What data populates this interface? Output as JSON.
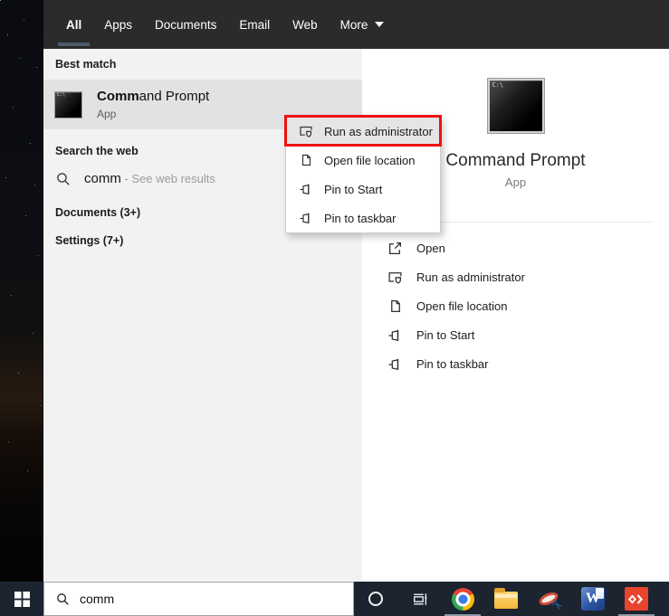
{
  "header": {
    "tabs": [
      {
        "label": "All",
        "selected": true
      },
      {
        "label": "Apps",
        "selected": false
      },
      {
        "label": "Documents",
        "selected": false
      },
      {
        "label": "Email",
        "selected": false
      },
      {
        "label": "Web",
        "selected": false
      },
      {
        "label": "More",
        "selected": false,
        "dropdown": true
      }
    ],
    "selected_underline_color": "#4d5b69",
    "background": "#2b2b2b"
  },
  "results": {
    "best_match_header": "Best match",
    "best_match": {
      "title_bold": "Comm",
      "title_rest": "and Prompt",
      "subtitle": "App",
      "icon": "command-prompt-icon"
    },
    "web_header": "Search the web",
    "web_suggestion": {
      "query": "comm",
      "suffix": " - See web results",
      "icon": "search-icon"
    },
    "documents_header": "Documents (3+)",
    "settings_header": "Settings (7+)"
  },
  "context_menu": {
    "annotation_color": "#ee1111",
    "items": [
      {
        "label": "Run as administrator",
        "icon": "run-as-admin-icon",
        "highlighted": true,
        "annotated": true
      },
      {
        "label": "Open file location",
        "icon": "open-file-location-icon",
        "highlighted": false
      },
      {
        "label": "Pin to Start",
        "icon": "pin-icon",
        "highlighted": false
      },
      {
        "label": "Pin to taskbar",
        "icon": "pin-icon",
        "highlighted": false
      }
    ]
  },
  "preview": {
    "app_name": "Command Prompt",
    "app_type": "App",
    "icon": "command-prompt-icon",
    "actions": [
      {
        "label": "Open",
        "icon": "open-icon"
      },
      {
        "label": "Run as administrator",
        "icon": "run-as-admin-icon"
      },
      {
        "label": "Open file location",
        "icon": "open-file-location-icon"
      },
      {
        "label": "Pin to Start",
        "icon": "pin-icon"
      },
      {
        "label": "Pin to taskbar",
        "icon": "pin-icon"
      }
    ]
  },
  "taskbar": {
    "background": "#1c2430",
    "search_value": "comm",
    "buttons": [
      {
        "name": "start",
        "icon": "windows-logo-icon"
      },
      {
        "name": "search-box",
        "icon": "search-icon"
      },
      {
        "name": "cortana",
        "icon": "cortana-icon"
      },
      {
        "name": "task-view",
        "icon": "task-view-icon"
      },
      {
        "name": "chrome",
        "icon": "chrome-icon",
        "active": true
      },
      {
        "name": "file-explorer",
        "icon": "folder-icon"
      },
      {
        "name": "snipping-tool",
        "icon": "snipping-tool-icon"
      },
      {
        "name": "word",
        "icon": "word-icon"
      },
      {
        "name": "red-arrows-app",
        "icon": "red-arrows-app-icon",
        "active": true
      }
    ]
  },
  "icons": {
    "cmd_glyph": "C:\\",
    "scissors_glyph": "✂",
    "word_glyph": "W"
  }
}
